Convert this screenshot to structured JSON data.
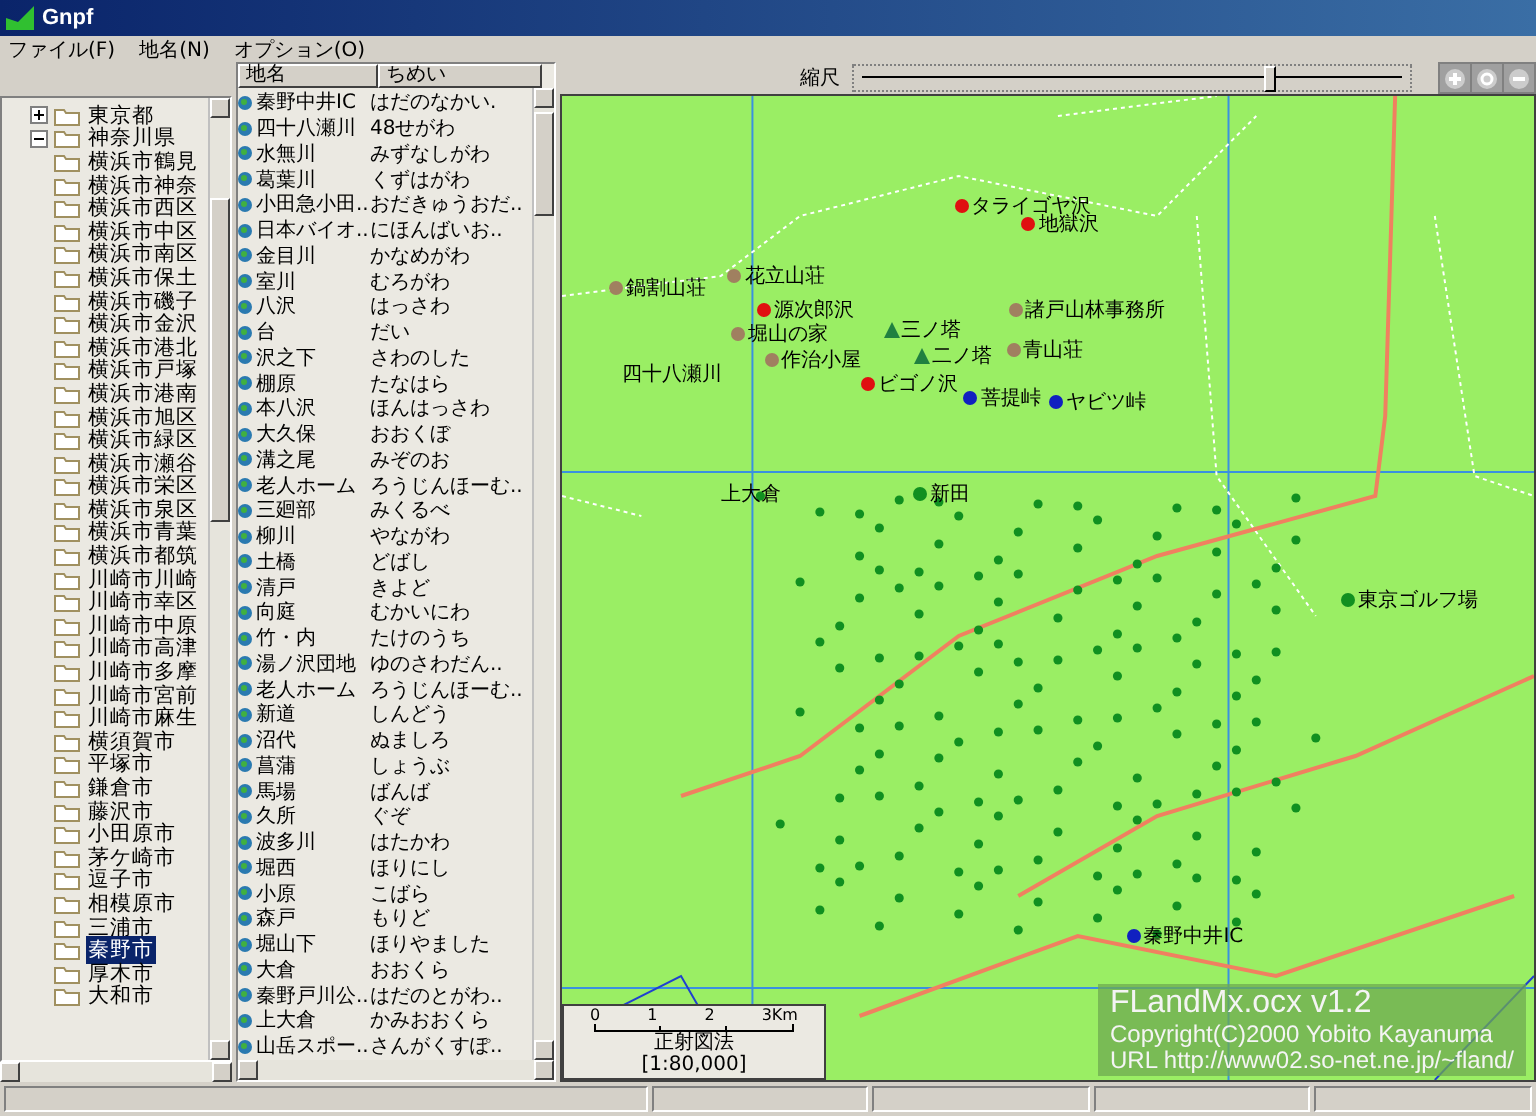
{
  "window": {
    "title": "Gnpf"
  },
  "menu": [
    "ファイル(F)",
    "地名(N)",
    "オプション(O)"
  ],
  "tree": [
    {
      "label": "東京都",
      "expanded": false,
      "selected": false
    },
    {
      "label": "神奈川県",
      "expanded": true,
      "selected": false,
      "children": [
        {
          "label": "横浜市鶴見",
          "selected": false
        },
        {
          "label": "横浜市神奈",
          "selected": false
        },
        {
          "label": "横浜市西区",
          "selected": false
        },
        {
          "label": "横浜市中区",
          "selected": false
        },
        {
          "label": "横浜市南区",
          "selected": false
        },
        {
          "label": "横浜市保土",
          "selected": false
        },
        {
          "label": "横浜市磯子",
          "selected": false
        },
        {
          "label": "横浜市金沢",
          "selected": false
        },
        {
          "label": "横浜市港北",
          "selected": false
        },
        {
          "label": "横浜市戸塚",
          "selected": false
        },
        {
          "label": "横浜市港南",
          "selected": false
        },
        {
          "label": "横浜市旭区",
          "selected": false
        },
        {
          "label": "横浜市緑区",
          "selected": false
        },
        {
          "label": "横浜市瀬谷",
          "selected": false
        },
        {
          "label": "横浜市栄区",
          "selected": false
        },
        {
          "label": "横浜市泉区",
          "selected": false
        },
        {
          "label": "横浜市青葉",
          "selected": false
        },
        {
          "label": "横浜市都筑",
          "selected": false
        },
        {
          "label": "川崎市川崎",
          "selected": false
        },
        {
          "label": "川崎市幸区",
          "selected": false
        },
        {
          "label": "川崎市中原",
          "selected": false
        },
        {
          "label": "川崎市高津",
          "selected": false
        },
        {
          "label": "川崎市多摩",
          "selected": false
        },
        {
          "label": "川崎市宮前",
          "selected": false
        },
        {
          "label": "川崎市麻生",
          "selected": false
        },
        {
          "label": "横須賀市",
          "selected": false
        },
        {
          "label": "平塚市",
          "selected": false
        },
        {
          "label": "鎌倉市",
          "selected": false
        },
        {
          "label": "藤沢市",
          "selected": false
        },
        {
          "label": "小田原市",
          "selected": false
        },
        {
          "label": "茅ケ崎市",
          "selected": false
        },
        {
          "label": "逗子市",
          "selected": false
        },
        {
          "label": "相模原市",
          "selected": false
        },
        {
          "label": "三浦市",
          "selected": false
        },
        {
          "label": "秦野市",
          "selected": true
        },
        {
          "label": "厚木市",
          "selected": false
        },
        {
          "label": "大和市",
          "selected": false
        }
      ]
    }
  ],
  "list": {
    "columns": [
      "地名",
      "ちめい"
    ],
    "rows": [
      [
        "秦野中井IC",
        "はだのなかい."
      ],
      [
        "四十八瀬川",
        "48せがわ"
      ],
      [
        "水無川",
        "みずなしがわ"
      ],
      [
        "葛葉川",
        "くずはがわ"
      ],
      [
        "小田急小田..",
        "おだきゅうおだ.."
      ],
      [
        "日本バイオ..",
        "にほんばいお.."
      ],
      [
        "金目川",
        "かなめがわ"
      ],
      [
        "室川",
        "むろがわ"
      ],
      [
        "八沢",
        "はっさわ"
      ],
      [
        "台",
        "だい"
      ],
      [
        "沢之下",
        "さわのした"
      ],
      [
        "棚原",
        "たなはら"
      ],
      [
        "本八沢",
        "ほんはっさわ"
      ],
      [
        "大久保",
        "おおくぼ"
      ],
      [
        "溝之尾",
        "みぞのお"
      ],
      [
        "老人ホーム",
        "ろうじんほーむ.."
      ],
      [
        "三廻部",
        "みくるべ"
      ],
      [
        "柳川",
        "やながわ"
      ],
      [
        "土橋",
        "どばし"
      ],
      [
        "清戸",
        "きよど"
      ],
      [
        "向庭",
        "むかいにわ"
      ],
      [
        "竹・内",
        "たけのうち"
      ],
      [
        "湯ノ沢団地",
        "ゆのさわだん.."
      ],
      [
        "老人ホーム",
        "ろうじんほーむ.."
      ],
      [
        "新道",
        "しんどう"
      ],
      [
        "沼代",
        "ぬましろ"
      ],
      [
        "菖蒲",
        "しょうぶ"
      ],
      [
        "馬場",
        "ばんば"
      ],
      [
        "久所",
        "ぐぞ"
      ],
      [
        "波多川",
        "はたかわ"
      ],
      [
        "堀西",
        "ほりにし"
      ],
      [
        "小原",
        "こばら"
      ],
      [
        "森戸",
        "もりど"
      ],
      [
        "堀山下",
        "ほりやました"
      ],
      [
        "大倉",
        "おおくら"
      ],
      [
        "秦野戸川公..",
        "はだのとがわ.."
      ],
      [
        "上大倉",
        "かみおおくら"
      ],
      [
        "山岳スポー..",
        "さんがくすぽ.."
      ]
    ]
  },
  "toolbar": {
    "scale_label": "縮尺",
    "scale": {
      "level": 0.75
    }
  },
  "map": {
    "labels": [
      {
        "text": "タライゴヤ沢",
        "kind": "red"
      },
      {
        "text": "地獄沢",
        "kind": "red"
      },
      {
        "text": "花立山荘",
        "kind": "brown"
      },
      {
        "text": "鍋割山荘",
        "kind": "brown"
      },
      {
        "text": "源次郎沢",
        "kind": "red"
      },
      {
        "text": "諸戸山林事務所",
        "kind": "brown"
      },
      {
        "text": "堀山の家",
        "kind": "brown"
      },
      {
        "text": "作治小屋",
        "kind": "brown"
      },
      {
        "text": "三ノ塔",
        "kind": "peak"
      },
      {
        "text": "二ノ塔",
        "kind": "peak"
      },
      {
        "text": "ビゴノ沢",
        "kind": "red"
      },
      {
        "text": "青山荘",
        "kind": "brown"
      },
      {
        "text": "菩提峠",
        "kind": "blue"
      },
      {
        "text": "ヤビツ峠",
        "kind": "blue"
      },
      {
        "text": "四十八瀬川",
        "kind": "plain"
      },
      {
        "text": "上大倉",
        "kind": "plain"
      },
      {
        "text": "新田",
        "kind": "green"
      },
      {
        "text": "東京ゴルフ場",
        "kind": "green"
      },
      {
        "text": "秦野中井IC",
        "kind": "blue"
      }
    ],
    "scale_bar": {
      "ticks": [
        "0",
        "1",
        "2",
        "3Km"
      ],
      "projection": "正射図法",
      "ratio": "[1:80,000]"
    },
    "credit": {
      "title": "FLandMx.ocx v1.2",
      "copyright": "Copyright(C)2000 Yobito Kayanuma",
      "url": "URL http://www02.so-net.ne.jp/~fland/"
    }
  }
}
